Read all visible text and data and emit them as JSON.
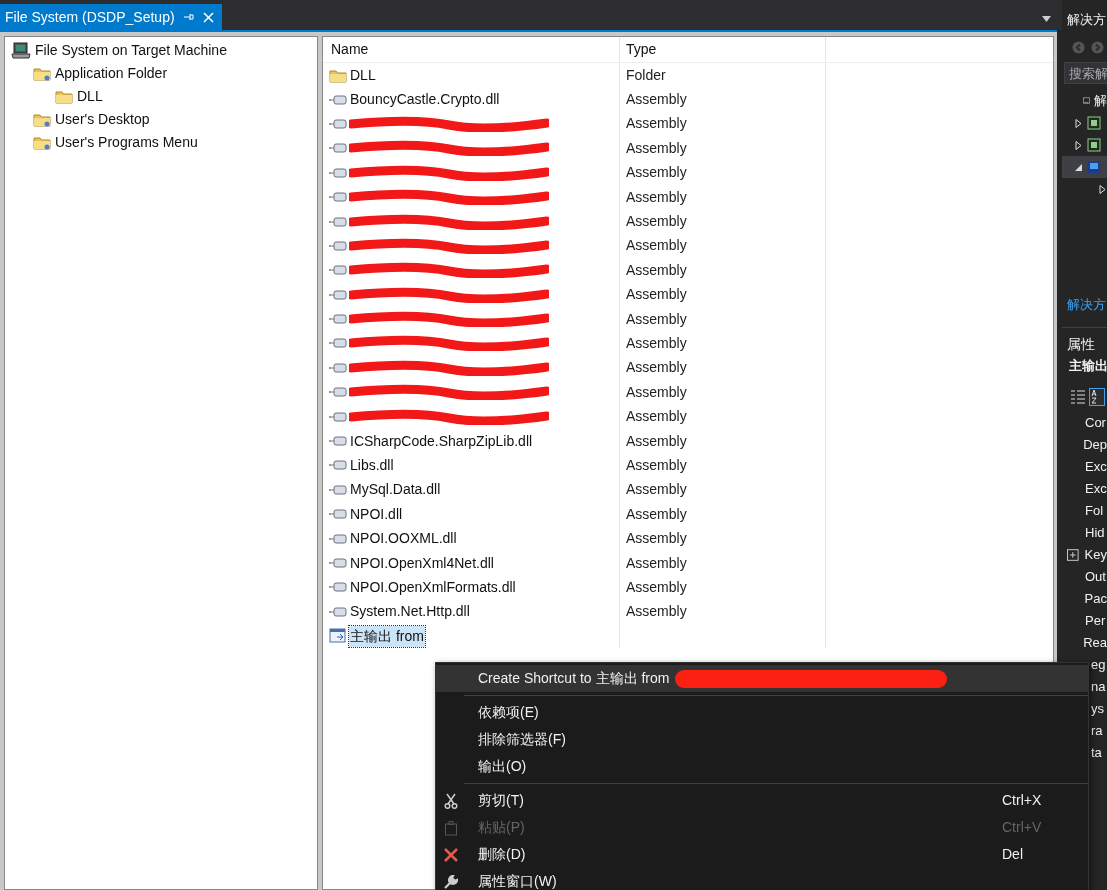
{
  "tab": {
    "title": "File System (DSDP_Setup)",
    "selected": true
  },
  "tree": [
    {
      "label": "File System on Target Machine",
      "kind": "machine",
      "children": [
        {
          "label": "Application Folder",
          "kind": "special-folder",
          "children": [
            {
              "label": "DLL",
              "kind": "folder"
            }
          ]
        },
        {
          "label": "User's Desktop",
          "kind": "special-folder"
        },
        {
          "label": "User's Programs Menu",
          "kind": "special-folder"
        }
      ]
    }
  ],
  "list": {
    "columns": [
      "Name",
      "Type"
    ],
    "rows": [
      {
        "name": "DLL",
        "type": "Folder",
        "kind": "folder",
        "redacted": false,
        "selected": false
      },
      {
        "name": "BouncyCastle.Crypto.dll",
        "type": "Assembly",
        "kind": "assembly",
        "redacted": false,
        "selected": false
      },
      {
        "type": "Assembly",
        "kind": "assembly",
        "redacted": true,
        "selected": false
      },
      {
        "type": "Assembly",
        "kind": "assembly",
        "redacted": true,
        "selected": false
      },
      {
        "type": "Assembly",
        "kind": "assembly",
        "redacted": true,
        "selected": false
      },
      {
        "type": "Assembly",
        "kind": "assembly",
        "redacted": true,
        "selected": false
      },
      {
        "type": "Assembly",
        "kind": "assembly",
        "redacted": true,
        "selected": false
      },
      {
        "type": "Assembly",
        "kind": "assembly",
        "redacted": true,
        "selected": false
      },
      {
        "type": "Assembly",
        "kind": "assembly",
        "redacted": true,
        "selected": false
      },
      {
        "type": "Assembly",
        "kind": "assembly",
        "redacted": true,
        "selected": false
      },
      {
        "type": "Assembly",
        "kind": "assembly",
        "redacted": true,
        "selected": false
      },
      {
        "type": "Assembly",
        "kind": "assembly",
        "redacted": true,
        "selected": false
      },
      {
        "type": "Assembly",
        "kind": "assembly",
        "redacted": true,
        "selected": false
      },
      {
        "type": "Assembly",
        "kind": "assembly",
        "redacted": true,
        "selected": false
      },
      {
        "type": "Assembly",
        "kind": "assembly",
        "redacted": true,
        "selected": false
      },
      {
        "name": "ICSharpCode.SharpZipLib.dll",
        "type": "Assembly",
        "kind": "assembly",
        "redacted": false,
        "selected": false
      },
      {
        "name": "Libs.dll",
        "type": "Assembly",
        "kind": "assembly",
        "redacted": false,
        "selected": false
      },
      {
        "name": "MySql.Data.dll",
        "type": "Assembly",
        "kind": "assembly",
        "redacted": false,
        "selected": false
      },
      {
        "name": "NPOI.dll",
        "type": "Assembly",
        "kind": "assembly",
        "redacted": false,
        "selected": false
      },
      {
        "name": "NPOI.OOXML.dll",
        "type": "Assembly",
        "kind": "assembly",
        "redacted": false,
        "selected": false
      },
      {
        "name": "NPOI.OpenXml4Net.dll",
        "type": "Assembly",
        "kind": "assembly",
        "redacted": false,
        "selected": false
      },
      {
        "name": "NPOI.OpenXmlFormats.dll",
        "type": "Assembly",
        "kind": "assembly",
        "redacted": false,
        "selected": false
      },
      {
        "name": "System.Net.Http.dll",
        "type": "Assembly",
        "kind": "assembly",
        "redacted": false,
        "selected": false
      },
      {
        "name": "主输出 from",
        "kind": "output",
        "redacted": false,
        "selected": true
      }
    ]
  },
  "context_menu": [
    {
      "kind": "item",
      "label": "Create Shortcut to 主输出 from",
      "redacted": true,
      "highlighted": true,
      "disabled": false
    },
    {
      "kind": "separator"
    },
    {
      "kind": "item",
      "label": "依赖项(E)",
      "redacted": false,
      "highlighted": false,
      "disabled": false
    },
    {
      "kind": "item",
      "label": "排除筛选器(F)",
      "redacted": false,
      "highlighted": false,
      "disabled": false
    },
    {
      "kind": "item",
      "label": "输出(O)",
      "redacted": false,
      "highlighted": false,
      "disabled": false
    },
    {
      "kind": "separator"
    },
    {
      "kind": "cut",
      "label": "剪切(T)",
      "shortcut": "Ctrl+X",
      "redacted": false,
      "highlighted": false,
      "disabled": false
    },
    {
      "kind": "paste",
      "label": "粘贴(P)",
      "shortcut": "Ctrl+V",
      "redacted": false,
      "highlighted": false,
      "disabled": true
    },
    {
      "kind": "delete",
      "label": "删除(D)",
      "shortcut": "Del",
      "redacted": false,
      "highlighted": false,
      "disabled": false
    },
    {
      "kind": "properties",
      "label": "属性窗口(W)",
      "redacted": false,
      "highlighted": false,
      "disabled": false
    }
  ],
  "solution_explorer": {
    "title": "解决方",
    "search": {
      "placeholder": "搜索解"
    },
    "items": [
      {
        "kind": "solution",
        "label": "解",
        "selected": false
      },
      {
        "kind": "project",
        "expanded": false,
        "selected": false
      },
      {
        "kind": "project",
        "expanded": false,
        "selected": false
      },
      {
        "kind": "setup",
        "expanded": true,
        "selected": true,
        "children": [
          {
            "kind": "node",
            "expanded": false,
            "selected": false
          }
        ]
      }
    ],
    "footer_tab": "解决方"
  },
  "properties": {
    "title": "属性",
    "object": "主输出",
    "rows": [
      {
        "label": "Cor",
        "kind": "plain"
      },
      {
        "label": "Dep",
        "kind": "plain"
      },
      {
        "label": "Exc",
        "kind": "plain"
      },
      {
        "label": "Exc",
        "kind": "plain"
      },
      {
        "label": "Fol",
        "kind": "plain"
      },
      {
        "label": "Hid",
        "kind": "plain"
      },
      {
        "label": "Key",
        "kind": "group"
      },
      {
        "label": "Out",
        "kind": "plain"
      },
      {
        "label": "Pac",
        "kind": "plain"
      },
      {
        "label": "Per",
        "kind": "plain"
      },
      {
        "label": "Rea",
        "kind": "plain"
      },
      {
        "label": "eg",
        "kind": "partial"
      },
      {
        "label": "na",
        "kind": "partial"
      },
      {
        "label": "ys",
        "kind": "partial"
      },
      {
        "label": "ra",
        "kind": "partial"
      },
      {
        "label": "ta",
        "kind": "partial"
      }
    ]
  }
}
